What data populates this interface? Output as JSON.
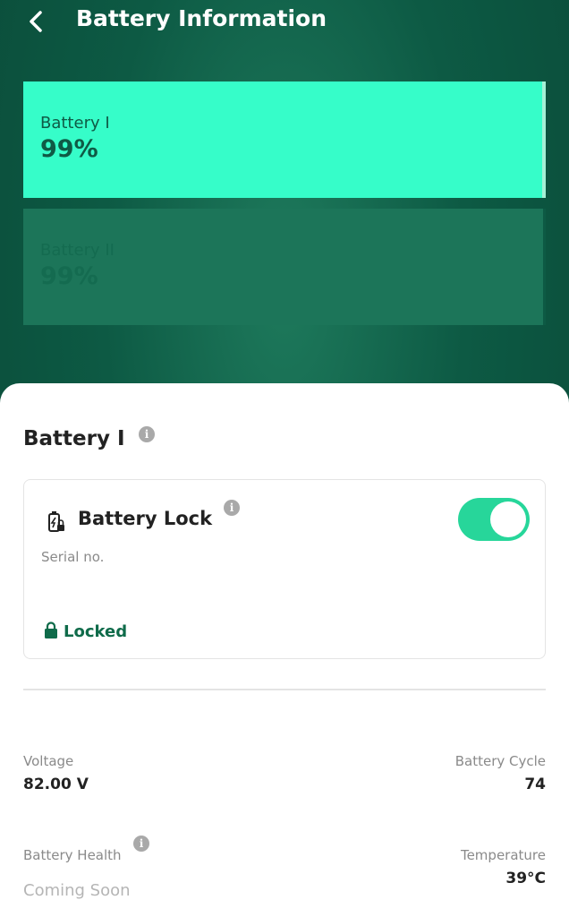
{
  "header": {
    "title": "Battery Information",
    "back_icon": "chevron-left-icon"
  },
  "batteries": [
    {
      "name": "Battery I",
      "percent": "99%",
      "selected": true
    },
    {
      "name": "Battery II",
      "percent": "99%",
      "selected": false
    }
  ],
  "detail": {
    "title": "Battery I",
    "info_icon": "info-icon",
    "lock_card": {
      "icon": "battery-lock-icon",
      "title": "Battery Lock",
      "serial_label": "Serial no.",
      "toggle_on": true,
      "status": "Locked",
      "status_icon": "padlock-icon"
    },
    "stats": {
      "voltage": {
        "label": "Voltage",
        "value": "82.00 V"
      },
      "cycle": {
        "label": "Battery Cycle",
        "value": "74"
      },
      "health": {
        "label": "Battery Health",
        "value": "Coming Soon"
      },
      "temperature": {
        "label": "Temperature",
        "value": "39°C"
      }
    }
  },
  "colors": {
    "accent": "#36fdc9",
    "toggle": "#27d69a",
    "background": "#0d5a44",
    "locked_text": "#0f6b4a"
  }
}
